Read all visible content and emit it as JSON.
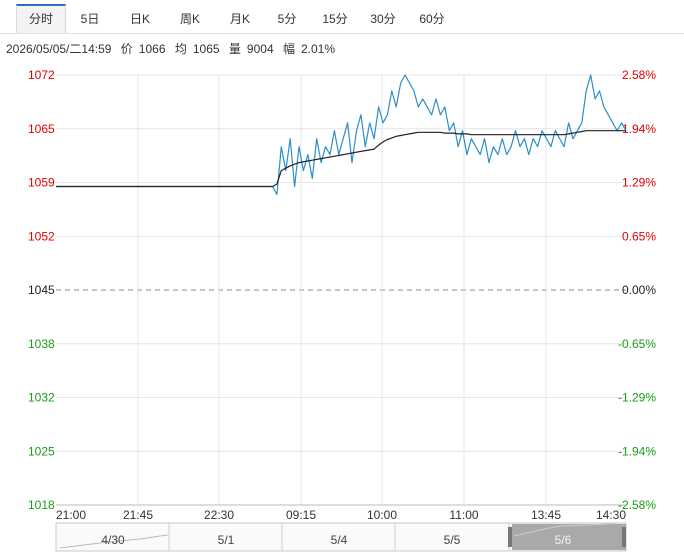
{
  "tabs": [
    {
      "label": "分时",
      "active": true
    },
    {
      "label": "5日"
    },
    {
      "label": "日K"
    },
    {
      "label": "周K"
    },
    {
      "label": "月K"
    },
    {
      "label": "5分"
    },
    {
      "label": "15分"
    },
    {
      "label": "30分"
    },
    {
      "label": "60分"
    }
  ],
  "info": {
    "datetime": "2026/05/05/二14:59",
    "price_label": "价",
    "price": "1066",
    "avg_label": "均",
    "avg": "1065",
    "vol_label": "量",
    "vol": "9004",
    "chg_label": "幅",
    "chg": "2.01%"
  },
  "colors": {
    "up": "#e00000",
    "down": "#1a9a1a",
    "neutral": "#222222",
    "price_line": "#2c8fc9",
    "avg_line": "#222222",
    "grid": "#e6e6e6"
  },
  "chart_data": {
    "type": "line",
    "prev_close": 1045,
    "y_ticks_left": [
      "1072",
      "1065",
      "1059",
      "1052",
      "1045",
      "1038",
      "1032",
      "1025",
      "1018"
    ],
    "y_ticks_right": [
      "2.58%",
      "1.94%",
      "1.29%",
      "0.65%",
      "0.00%",
      "-0.65%",
      "-1.29%",
      "-1.94%",
      "-2.58%"
    ],
    "ylim": [
      1018,
      1072
    ],
    "x_ticks": [
      "21:00",
      "21:45",
      "22:30",
      "09:15",
      "10:00",
      "11:00",
      "13:45",
      "14:30"
    ],
    "series": [
      {
        "values": [
          1058,
          1058,
          1058,
          1058,
          1058,
          1058,
          1058,
          1058,
          1058,
          1058,
          1058,
          1058,
          1058,
          1058,
          1058,
          1058,
          1058,
          1058,
          1058,
          1058,
          1058,
          1058,
          1058,
          1058,
          1058,
          1058,
          1058,
          1058,
          1058,
          1058,
          1058,
          1058,
          1058,
          1058,
          1058,
          1058,
          1058,
          1058,
          1058,
          1058,
          1058,
          1058,
          1058,
          1058,
          1058,
          1058,
          1058,
          1058,
          1058,
          1058,
          1057,
          1063,
          1060,
          1064,
          1058,
          1063,
          1060,
          1062,
          1059,
          1064,
          1061,
          1063,
          1062,
          1065,
          1062,
          1064,
          1066,
          1061,
          1065,
          1067,
          1063,
          1066,
          1064,
          1068,
          1066,
          1067,
          1070,
          1068,
          1071,
          1072,
          1071,
          1070,
          1068,
          1069,
          1068,
          1067,
          1069,
          1067,
          1068,
          1065,
          1066,
          1063,
          1065,
          1062,
          1064,
          1063,
          1062,
          1064,
          1061,
          1063,
          1062,
          1064,
          1062,
          1063,
          1065,
          1063,
          1064,
          1062,
          1064,
          1063,
          1065,
          1064,
          1063,
          1065,
          1064,
          1063,
          1066,
          1064,
          1065,
          1066,
          1070,
          1072,
          1069,
          1070,
          1068,
          1067,
          1066,
          1065,
          1066,
          1065
        ]
      },
      {
        "values": [
          1058,
          1058,
          1058,
          1058,
          1058,
          1058,
          1058,
          1058,
          1058,
          1058,
          1058,
          1058,
          1058,
          1058,
          1058,
          1058,
          1058,
          1058,
          1058,
          1058,
          1058,
          1058,
          1058,
          1058,
          1058,
          1058,
          1058,
          1058,
          1058,
          1058,
          1058,
          1058,
          1058,
          1058,
          1058,
          1058,
          1058,
          1058,
          1058,
          1058,
          1058,
          1058,
          1058,
          1058,
          1058,
          1058,
          1058,
          1058,
          1058,
          1058,
          1058.3,
          1060,
          1060.3,
          1060.6,
          1060.8,
          1061,
          1061.1,
          1061.2,
          1061.3,
          1061.4,
          1061.5,
          1061.6,
          1061.7,
          1061.8,
          1061.9,
          1062,
          1062.1,
          1062.2,
          1062.3,
          1062.4,
          1062.5,
          1062.6,
          1062.7,
          1063.2,
          1063.6,
          1063.9,
          1064.1,
          1064.3,
          1064.4,
          1064.5,
          1064.6,
          1064.7,
          1064.8,
          1064.8,
          1064.8,
          1064.8,
          1064.8,
          1064.8,
          1064.7,
          1064.7,
          1064.7,
          1064.6,
          1064.6,
          1064.6,
          1064.5,
          1064.5,
          1064.5,
          1064.5,
          1064.5,
          1064.5,
          1064.5,
          1064.5,
          1064.5,
          1064.5,
          1064.5,
          1064.5,
          1064.5,
          1064.5,
          1064.5,
          1064.5,
          1064.5,
          1064.5,
          1064.5,
          1064.5,
          1064.5,
          1064.5,
          1064.6,
          1064.7,
          1064.8,
          1064.9,
          1065,
          1065,
          1065,
          1065,
          1065,
          1065,
          1065,
          1065,
          1065,
          1065
        ]
      }
    ],
    "navigator": {
      "labels": [
        "4/30",
        "5/1",
        "5/4",
        "5/5",
        "5/6"
      ]
    }
  }
}
